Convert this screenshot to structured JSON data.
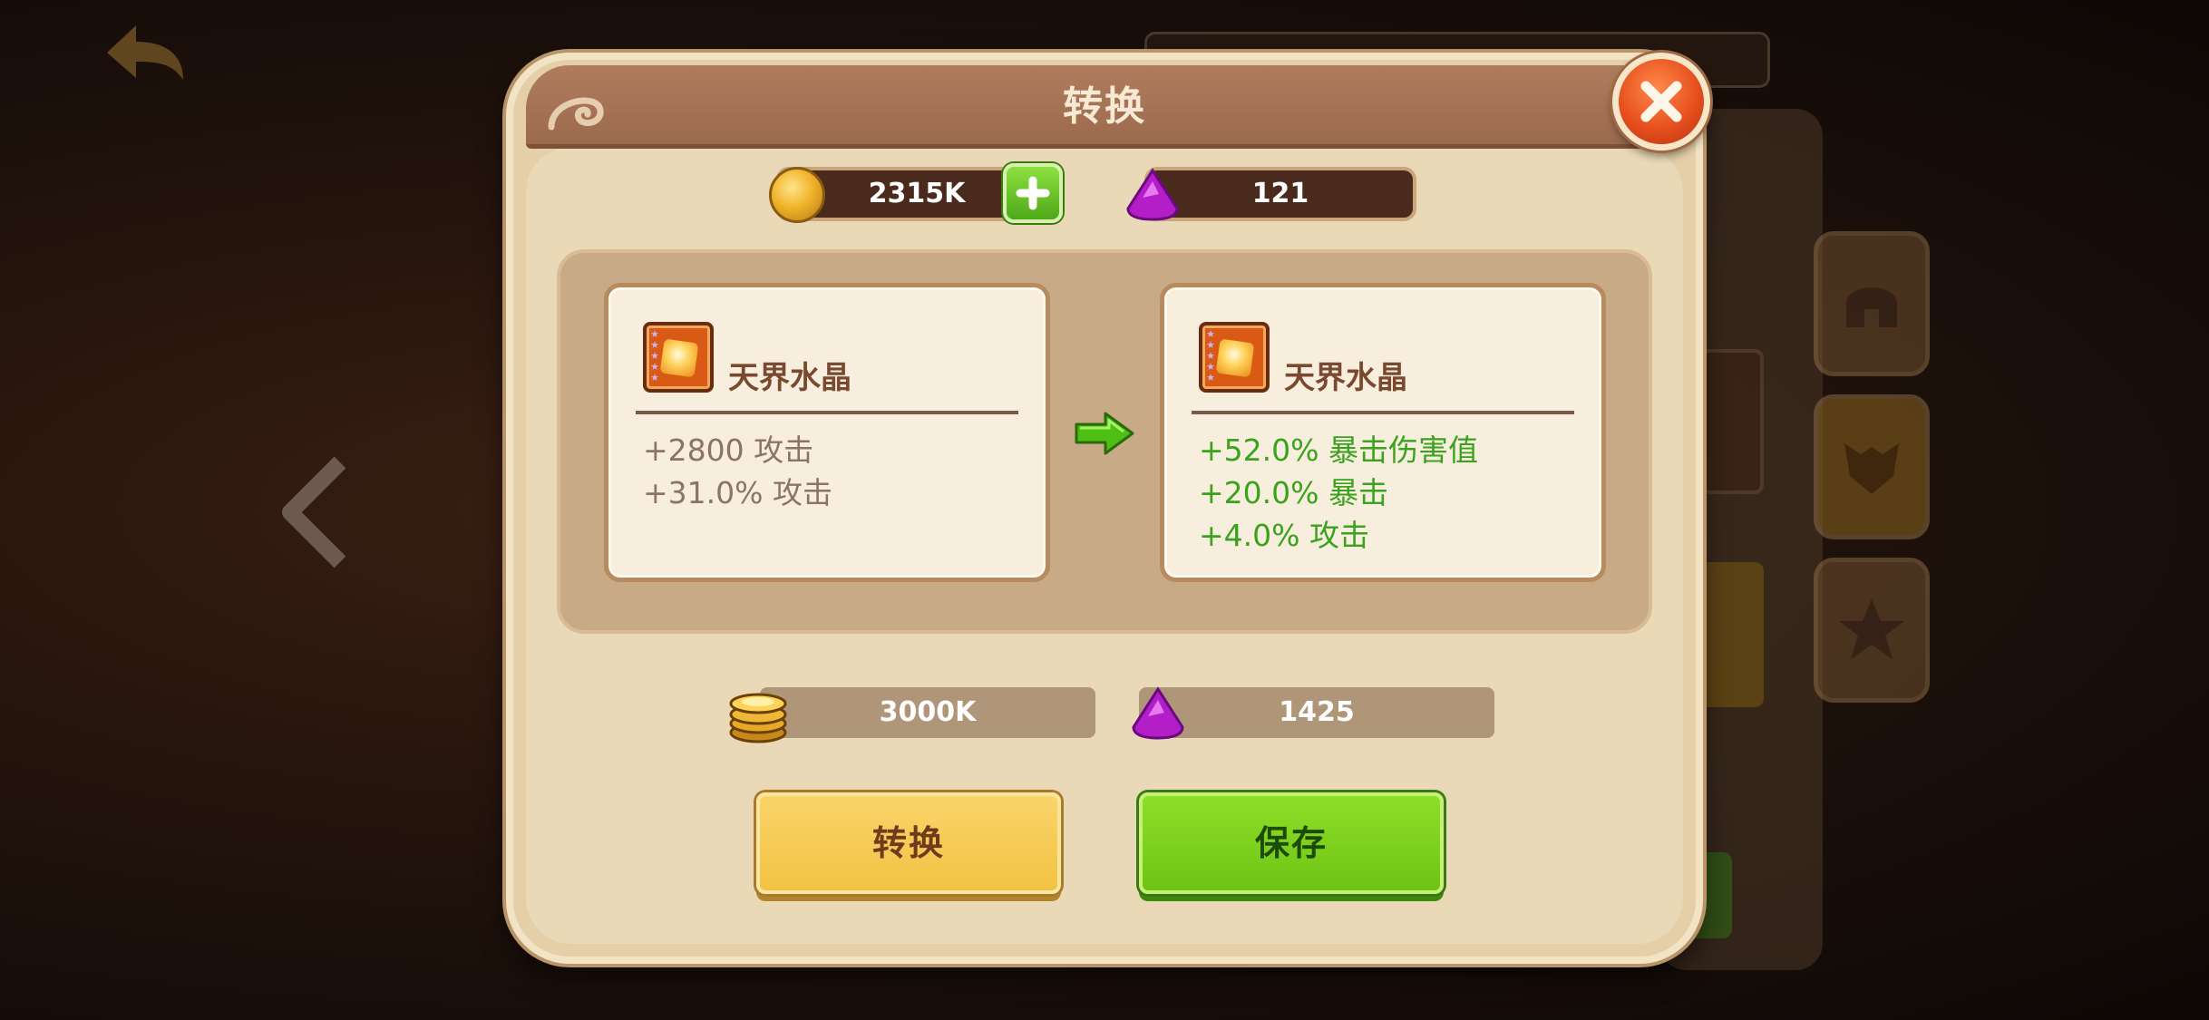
{
  "dialog": {
    "title": "转换"
  },
  "currency": {
    "gold": "2315K",
    "gems": "121"
  },
  "source_item": {
    "name": "天界水晶",
    "stats": [
      "+2800 攻击",
      "+31.0% 攻击"
    ]
  },
  "result_item": {
    "name": "天界水晶",
    "stats": [
      "+52.0% 暴击伤害值",
      "+20.0% 暴击",
      "+4.0% 攻击"
    ]
  },
  "cost": {
    "gold": "3000K",
    "gems": "1425"
  },
  "buttons": {
    "convert": "转换",
    "save": "保存"
  },
  "icons": {
    "back": "back-arrow-icon",
    "close": "close-icon",
    "gold": "gold-coin-icon",
    "gem": "purple-gem-icon",
    "add": "plus-icon",
    "arrow": "right-arrow-icon"
  },
  "colors": {
    "positive_stat": "#3aa21c",
    "neutral_stat": "#8c7462",
    "convert_button": "#f2c244",
    "save_button": "#6ec414",
    "close_button": "#e6501e"
  }
}
